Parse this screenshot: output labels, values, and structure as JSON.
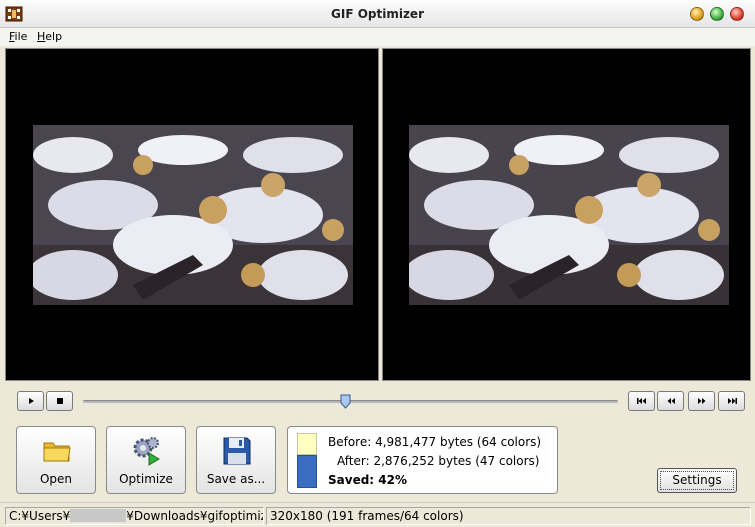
{
  "window": {
    "title": "GIF Optimizer"
  },
  "menu": {
    "file": "File",
    "help": "Help"
  },
  "buttons": {
    "open": "Open",
    "optimize": "Optimize",
    "save_as": "Save as...",
    "settings": "Settings"
  },
  "playback": {
    "play_icon": "play-icon",
    "stop_icon": "stop-icon",
    "first_icon": "first-frame-icon",
    "prev_icon": "previous-frame-icon",
    "next_icon": "next-frame-icon",
    "last_icon": "last-frame-icon",
    "position_fraction": 0.49
  },
  "stats": {
    "before": "Before: 4,981,477 bytes (64 colors)",
    "after": "After: 2,876,252 bytes (47 colors)",
    "saved": "Saved: 42%"
  },
  "status": {
    "path_start": "C:¥Users¥",
    "path_end": "¥Downloads¥gifoptimizer¥W",
    "info": "320x180 (191 frames/64 colors)"
  },
  "colors": {
    "after_bar": "#3a6ec0",
    "before_bar": "#ffffc0",
    "preview_bg": "#000000"
  }
}
